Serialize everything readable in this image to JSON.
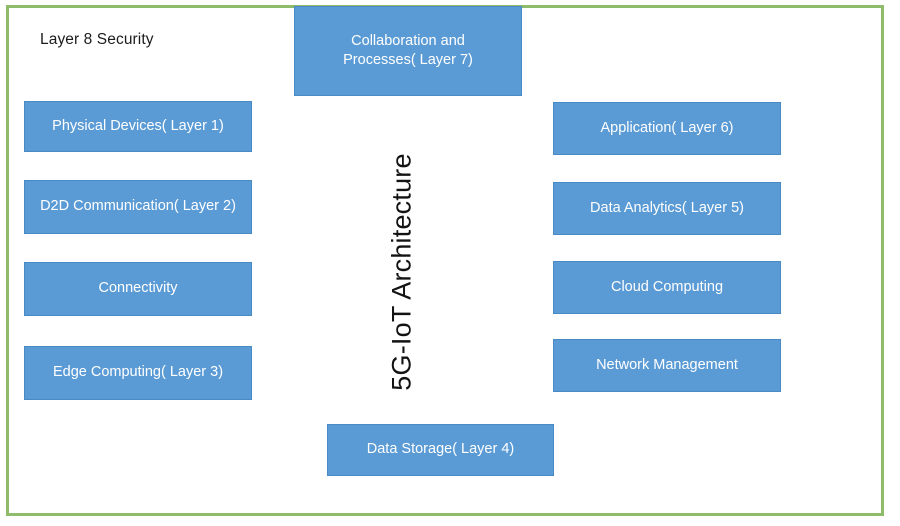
{
  "frame": {
    "border_color": "#8FBC6B",
    "background": "#ffffff"
  },
  "theme": {
    "node_fill": "#5B9BD5",
    "node_border": "#4A8AC4",
    "node_text": "#ffffff",
    "caption_text": "#1c1c1c",
    "title_text": "#131313"
  },
  "caption": {
    "layer8": "Layer 8 Security"
  },
  "center_title": "5G-IoT Architecture",
  "chart_data": {
    "type": "diagram",
    "title": "5G-IoT Architecture",
    "annotations": [
      "Layer 8 Security"
    ],
    "layout": "two-column layered stack with top and bottom center nodes",
    "nodes": [
      {
        "id": "collaboration",
        "label": "Collaboration and Processes( Layer 7)",
        "layer": 7,
        "column": "top-center"
      },
      {
        "id": "physical-devices",
        "label": "Physical Devices( Layer 1)",
        "layer": 1,
        "column": "left"
      },
      {
        "id": "d2d",
        "label": "D2D Communication( Layer 2)",
        "layer": 2,
        "column": "left"
      },
      {
        "id": "connectivity",
        "label": "Connectivity",
        "layer": null,
        "column": "left"
      },
      {
        "id": "edge-computing",
        "label": "Edge Computing( Layer 3)",
        "layer": 3,
        "column": "left"
      },
      {
        "id": "application",
        "label": "Application( Layer 6)",
        "layer": 6,
        "column": "right"
      },
      {
        "id": "data-analytics",
        "label": "Data Analytics( Layer 5)",
        "layer": 5,
        "column": "right"
      },
      {
        "id": "cloud-computing",
        "label": "Cloud Computing",
        "layer": null,
        "column": "right"
      },
      {
        "id": "network-mgmt",
        "label": "Network Management",
        "layer": null,
        "column": "right"
      },
      {
        "id": "data-storage",
        "label": "Data Storage( Layer 4)",
        "layer": 4,
        "column": "bottom-center"
      }
    ]
  },
  "boxes": {
    "collaboration_line1": "Collaboration and",
    "collaboration_line2": "Processes( Layer 7)",
    "physical_devices": "Physical Devices( Layer 1)",
    "d2d": "D2D Communication( Layer 2)",
    "connectivity": "Connectivity",
    "edge_computing": "Edge Computing( Layer 3)",
    "application": "Application( Layer 6)",
    "data_analytics": "Data Analytics( Layer 5)",
    "cloud_computing": "Cloud Computing",
    "network_management": "Network Management",
    "data_storage": "Data Storage( Layer 4)"
  }
}
